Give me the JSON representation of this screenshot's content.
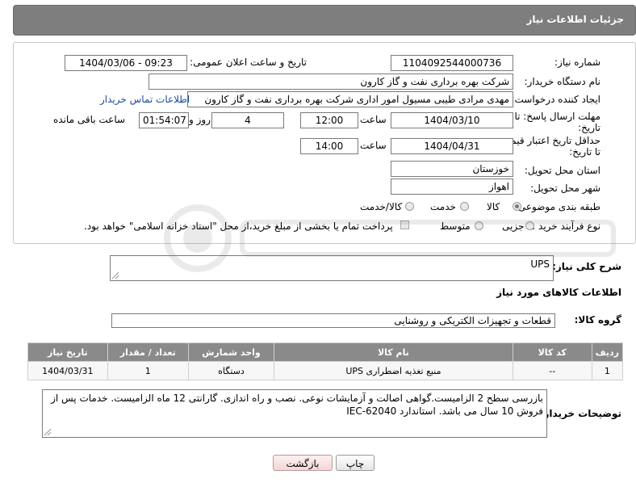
{
  "header": {
    "title": "جزئیات اطلاعات نیاز"
  },
  "form": {
    "need_number": {
      "label": "شماره نیاز:",
      "value": "1104092544000736"
    },
    "announce_datetime": {
      "label": "تاریخ و ساعت اعلان عمومی:",
      "value": "1404/03/06 - 09:23"
    },
    "buyer_org": {
      "label": "نام دستگاه خریدار:",
      "value": "شرکت بهره برداری نفت و گاز کارون"
    },
    "requester": {
      "label": "ایجاد کننده درخواست:",
      "value": "مهدی مرادی طیبی مسیول امور اداری شرکت بهره برداری نفت و گاز کارون",
      "contact_link": "اطلاعات تماس خریدار"
    },
    "reply_deadline": {
      "label_line1": "مهلت ارسال پاسخ: تا",
      "label_line2": "تاریخ:",
      "date": "1404/03/10",
      "time_label": "ساعت",
      "time": "12:00",
      "days": "4",
      "days_label": "روز و",
      "remaining": "01:54:07",
      "remaining_label": "ساعت باقی مانده"
    },
    "price_validity": {
      "label_line1": "حداقل تاریخ اعتبار قیمت:",
      "label_line2": "تا تاریخ:",
      "date": "1404/04/31",
      "time_label": "ساعت",
      "time": "14:00"
    },
    "province": {
      "label": "استان محل تحویل:",
      "value": "خوزستان"
    },
    "city": {
      "label": "شهر محل تحویل:",
      "value": "اهواز"
    },
    "category": {
      "label": "طبقه بندی موضوعی:",
      "options": [
        "کالا",
        "خدمت",
        "کالا/خدمت"
      ],
      "selected": "کالا"
    },
    "process_type": {
      "label": "نوع فرآیند خرید :",
      "options": [
        "جزیی",
        "متوسط"
      ],
      "payment_note": "پرداخت تمام یا بخشی از مبلغ خرید،از محل \"اسناد خزانه اسلامی\" خواهد بود."
    }
  },
  "general_description": {
    "label": "شرح کلی نیاز:",
    "value": "UPS"
  },
  "goods_info": {
    "title": "اطلاعات کالاهای مورد نیاز",
    "group_label": "گروه کالا:",
    "group_value": "قطعات و تجهیزات الکتریکی و روشنایی"
  },
  "items_table": {
    "headers": [
      "ردیف",
      "کد کالا",
      "نام کالا",
      "واحد شمارش",
      "تعداد / مقدار",
      "تاریخ نیاز"
    ],
    "rows": [
      [
        "1",
        "--",
        "منبع تغذیه اضطراری UPS",
        "دستگاه",
        "1",
        "1404/03/31"
      ]
    ]
  },
  "buyer_notes": {
    "label": "توضیحات خریدار:",
    "value": "بازرسی سطح 2 الزامیست.گواهی اصالت و آزمایشات نوعی. نصب و راه اندازی. گارانتی 12 ماه الزامیست. خدمات پس از فروش 10 سال می باشد. استاندارد IEC-62040"
  },
  "buttons": {
    "print": "چاپ",
    "back": "بازگشت"
  },
  "colors": {
    "header_bg": "#7e7e7e",
    "table_header_bg": "#8a8a8a",
    "link": "#1a4c9e"
  }
}
